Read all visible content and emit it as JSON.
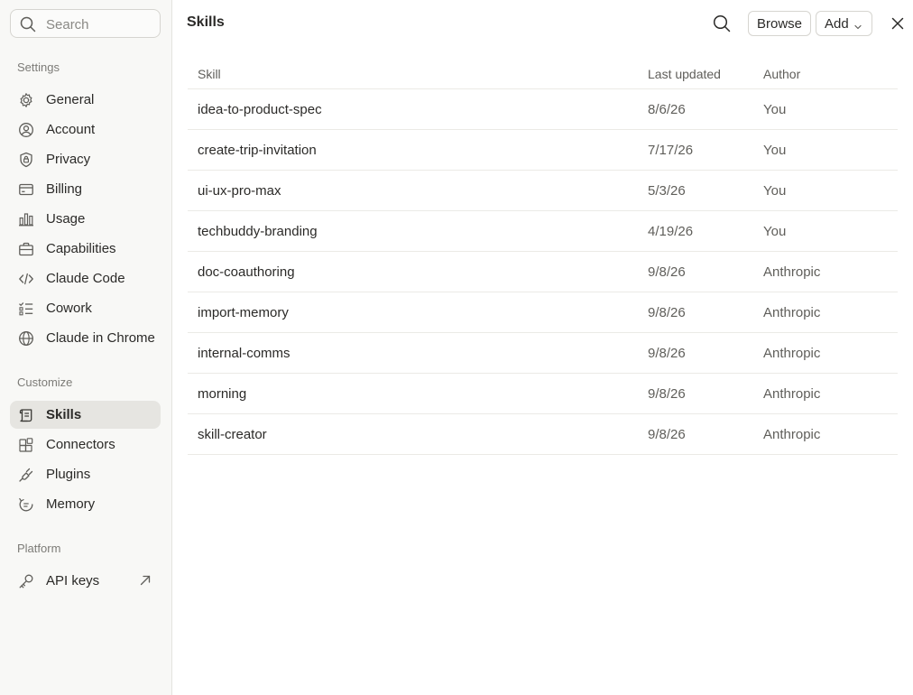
{
  "sidebar": {
    "search_placeholder": "Search",
    "sections": {
      "settings": "Settings",
      "customize": "Customize",
      "platform": "Platform"
    },
    "settings_items": [
      {
        "label": "General",
        "icon": "gear-icon"
      },
      {
        "label": "Account",
        "icon": "user-circle-icon"
      },
      {
        "label": "Privacy",
        "icon": "shield-lock-icon"
      },
      {
        "label": "Billing",
        "icon": "credit-card-icon"
      },
      {
        "label": "Usage",
        "icon": "bar-chart-icon"
      },
      {
        "label": "Capabilities",
        "icon": "briefcase-icon"
      },
      {
        "label": "Claude Code",
        "icon": "code-icon"
      },
      {
        "label": "Cowork",
        "icon": "checklist-icon"
      },
      {
        "label": "Claude in Chrome",
        "icon": "globe-icon"
      }
    ],
    "customize_items": [
      {
        "label": "Skills",
        "icon": "scroll-icon",
        "active": true
      },
      {
        "label": "Connectors",
        "icon": "blocks-icon"
      },
      {
        "label": "Plugins",
        "icon": "plug-icon"
      },
      {
        "label": "Memory",
        "icon": "memory-icon"
      }
    ],
    "platform_items": [
      {
        "label": "API keys",
        "icon": "key-icon",
        "external": true
      }
    ]
  },
  "header": {
    "title": "Skills",
    "browse_label": "Browse",
    "add_label": "Add"
  },
  "table": {
    "columns": [
      "Skill",
      "Last updated",
      "Author"
    ],
    "rows": [
      {
        "skill": "idea-to-product-spec",
        "updated": "8/6/26",
        "author": "You"
      },
      {
        "skill": "create-trip-invitation",
        "updated": "7/17/26",
        "author": "You"
      },
      {
        "skill": "ui-ux-pro-max",
        "updated": "5/3/26",
        "author": "You"
      },
      {
        "skill": "techbuddy-branding",
        "updated": "4/19/26",
        "author": "You"
      },
      {
        "skill": "doc-coauthoring",
        "updated": "9/8/26",
        "author": "Anthropic"
      },
      {
        "skill": "import-memory",
        "updated": "9/8/26",
        "author": "Anthropic"
      },
      {
        "skill": "internal-comms",
        "updated": "9/8/26",
        "author": "Anthropic"
      },
      {
        "skill": "morning",
        "updated": "9/8/26",
        "author": "Anthropic"
      },
      {
        "skill": "skill-creator",
        "updated": "9/8/26",
        "author": "Anthropic"
      }
    ]
  }
}
